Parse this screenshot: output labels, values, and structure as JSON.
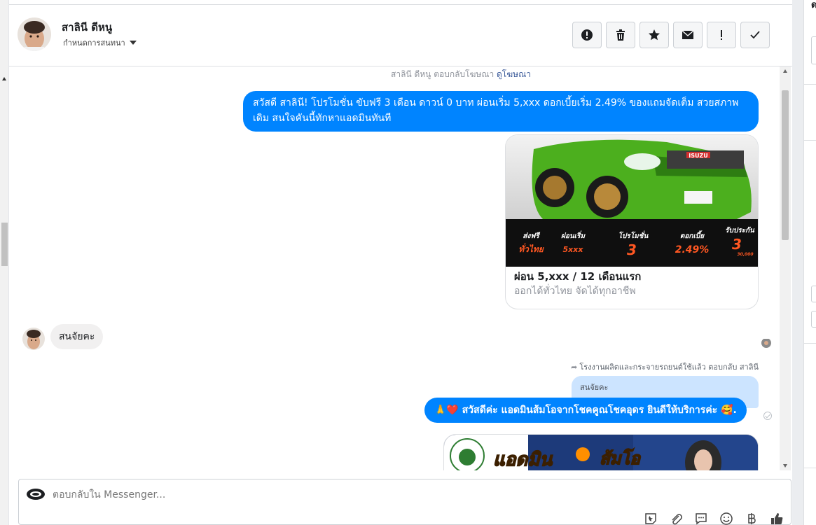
{
  "header": {
    "contact_name": "สาลินี ดีหนู",
    "assign_label": "กำหนดการสนทนา",
    "actions": [
      {
        "name": "report-spam",
        "icon": "alert-circle-icon"
      },
      {
        "name": "delete",
        "icon": "trash-icon"
      },
      {
        "name": "star",
        "icon": "star-icon"
      },
      {
        "name": "mark-unread",
        "icon": "envelope-icon"
      },
      {
        "name": "priority",
        "icon": "exclamation-icon"
      },
      {
        "name": "mark-done",
        "icon": "check-icon"
      }
    ]
  },
  "conversation": {
    "ad_reply_note": "สาลินี ดีหนู ตอบกลับโฆษณา",
    "ad_link": "ดูโฆษณา",
    "message_1": "สวัสดี สาลินี! โปรโมชั่น ขับฟรี 3 เดือน ดาวน์ 0 บาท ผ่อนเริ่ม 5,xxx  ดอกเบี้ยเริ่ม 2.49% ของแถมจัดเต็ม สวยสภาพเดิม สนใจคันนี้ทักหาแอดมินทันที",
    "card": {
      "title": "ผ่อน 5,xxx / 12 เดือนแรก",
      "subtitle": "ออกได้ทั่วไทย จัดได้ทุกอาชีพ",
      "image_text": {
        "brand": "ISUZU",
        "promos": [
          {
            "label": "ส่งฟรี",
            "value": "ทั่วไทย"
          },
          {
            "label": "ผ่อนเริ่ม",
            "value": "5xxx"
          },
          {
            "label": "โปรโมชั่น",
            "value": "3"
          },
          {
            "label": "ดอกเบี้ย",
            "value": "2.49%"
          },
          {
            "label": "รับประกัน",
            "value": "3",
            "extra": "30,000"
          }
        ]
      }
    },
    "incoming_message": "สนจัยคะ",
    "reply_note": "โรงงานผลิตและกระจายรถยนต์ใช้แล้ว ตอบกลับ สาลินี",
    "quoted_text": "สนจัยคะ",
    "message_2": "🙏❤️ สวัสดีค่ะ แอดมินส้มโอจากโชคคูณโชคอุดร ยินดีให้บริการค่ะ 🥰.",
    "card2": {
      "banner_text": "แอดมิน",
      "banner_text_2": "ส้มโอ"
    }
  },
  "composer": {
    "placeholder": "ตอบกลับใน Messenger...",
    "tools": [
      "sticker-icon",
      "paperclip-icon",
      "saved-reply-icon",
      "emoji-icon",
      "baht-icon",
      "thumbs-up-icon"
    ]
  },
  "colors": {
    "outgoing_bubble": "#0084ff",
    "incoming_bubble": "#f1f0f0",
    "quote_bubble": "#cce4ff",
    "link": "#385898"
  }
}
